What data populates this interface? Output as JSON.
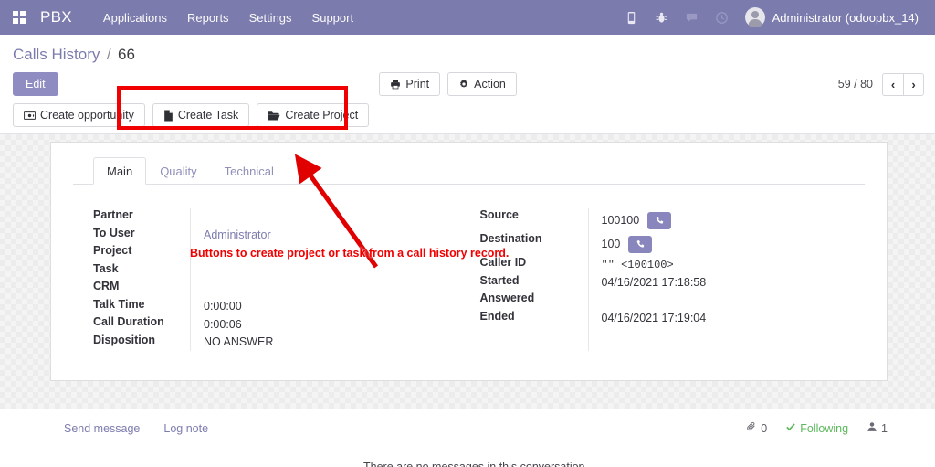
{
  "navbar": {
    "apps_icon": "apps-grid-icon",
    "brand": "PBX",
    "menu": [
      {
        "label": "Applications"
      },
      {
        "label": "Reports"
      },
      {
        "label": "Settings"
      },
      {
        "label": "Support"
      }
    ],
    "icons": [
      {
        "name": "phone-icon"
      },
      {
        "name": "bug-icon"
      },
      {
        "name": "chat-icon"
      },
      {
        "name": "clock-icon"
      }
    ],
    "user": "Administrator (odoopbx_14)",
    "bg_color": "#7c7bad"
  },
  "breadcrumb": {
    "root": "Calls History",
    "separator": "/",
    "record_id": "66"
  },
  "controlpanel": {
    "edit_label": "Edit",
    "print_label": "Print",
    "action_label": "Action",
    "pager_count": "59 / 80",
    "prev_label": "‹",
    "next_label": "›"
  },
  "sheet_buttons": [
    {
      "label": "Create opportunity",
      "icon": "money-bill-icon"
    },
    {
      "label": "Create Task",
      "icon": "file-icon"
    },
    {
      "label": "Create Project",
      "icon": "folder-open-icon"
    }
  ],
  "tabs": [
    {
      "label": "Main",
      "active": true
    },
    {
      "label": "Quality",
      "active": false
    },
    {
      "label": "Technical",
      "active": false
    }
  ],
  "form": {
    "left": [
      {
        "label": "Partner",
        "value": ""
      },
      {
        "label": "To User",
        "value": "Administrator",
        "link": true
      },
      {
        "label": "Project",
        "value": ""
      },
      {
        "label": "Task",
        "value": ""
      },
      {
        "label": "CRM",
        "value": ""
      },
      {
        "label": "Talk Time",
        "value": "0:00:00"
      },
      {
        "label": "Call Duration",
        "value": "0:00:06"
      },
      {
        "label": "Disposition",
        "value": "NO ANSWER"
      }
    ],
    "right": [
      {
        "label": "Source",
        "value": "100100",
        "call_button": true
      },
      {
        "label": "Destination",
        "value": "100",
        "call_button": true
      },
      {
        "label": "Caller ID",
        "value": "\"\" <100100>"
      },
      {
        "label": "Started",
        "value": "04/16/2021 17:18:58"
      },
      {
        "label": "Answered",
        "value": ""
      },
      {
        "label": "Ended",
        "value": "04/16/2021 17:19:04"
      }
    ]
  },
  "chatter": {
    "send_message": "Send message",
    "log_note": "Log note",
    "attachment_count": "0",
    "following_label": "Following",
    "follower_count": "1",
    "empty_message": "There are no messages in this conversation.",
    "following_color": "#5cb85c"
  },
  "annotations": {
    "text": "Buttons to create project or task from a call history record.",
    "color": "#f20000"
  }
}
